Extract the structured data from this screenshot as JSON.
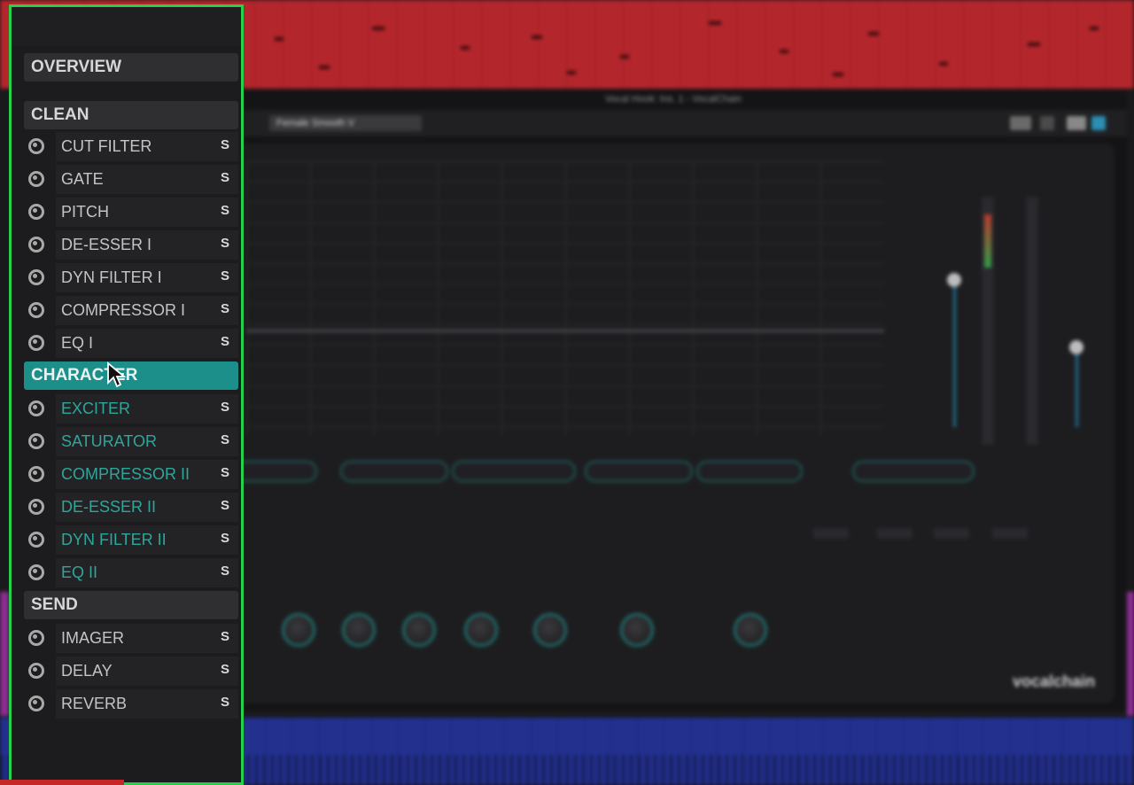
{
  "plugin": {
    "window_title": "Vocal Hook: Ins. 1 - VocalChain",
    "preset_name": "Female Smooth V",
    "brand": "vocalchain"
  },
  "sidebar": {
    "sections": [
      {
        "title": "OVERVIEW",
        "active": false,
        "items": []
      },
      {
        "title": "CLEAN",
        "active": false,
        "items": [
          {
            "label": "CUT FILTER",
            "solo": "S"
          },
          {
            "label": "GATE",
            "solo": "S"
          },
          {
            "label": "PITCH",
            "solo": "S"
          },
          {
            "label": "DE-ESSER I",
            "solo": "S"
          },
          {
            "label": "DYN FILTER I",
            "solo": "S"
          },
          {
            "label": "COMPRESSOR I",
            "solo": "S"
          },
          {
            "label": "EQ I",
            "solo": "S"
          }
        ]
      },
      {
        "title": "CHARACTER",
        "active": true,
        "items": [
          {
            "label": "EXCITER",
            "solo": "S"
          },
          {
            "label": "SATURATOR",
            "solo": "S"
          },
          {
            "label": "COMPRESSOR II",
            "solo": "S"
          },
          {
            "label": "DE-ESSER II",
            "solo": "S"
          },
          {
            "label": "DYN FILTER II",
            "solo": "S"
          },
          {
            "label": "EQ II",
            "solo": "S"
          }
        ]
      },
      {
        "title": "SEND",
        "active": false,
        "items": [
          {
            "label": "IMAGER",
            "solo": "S"
          },
          {
            "label": "DELAY",
            "solo": "S"
          },
          {
            "label": "REVERB",
            "solo": "S"
          }
        ]
      }
    ]
  },
  "colors": {
    "highlight_border": "#25d04a",
    "active_section": "#1d8f8a",
    "character_item_text": "#2fa59b"
  }
}
